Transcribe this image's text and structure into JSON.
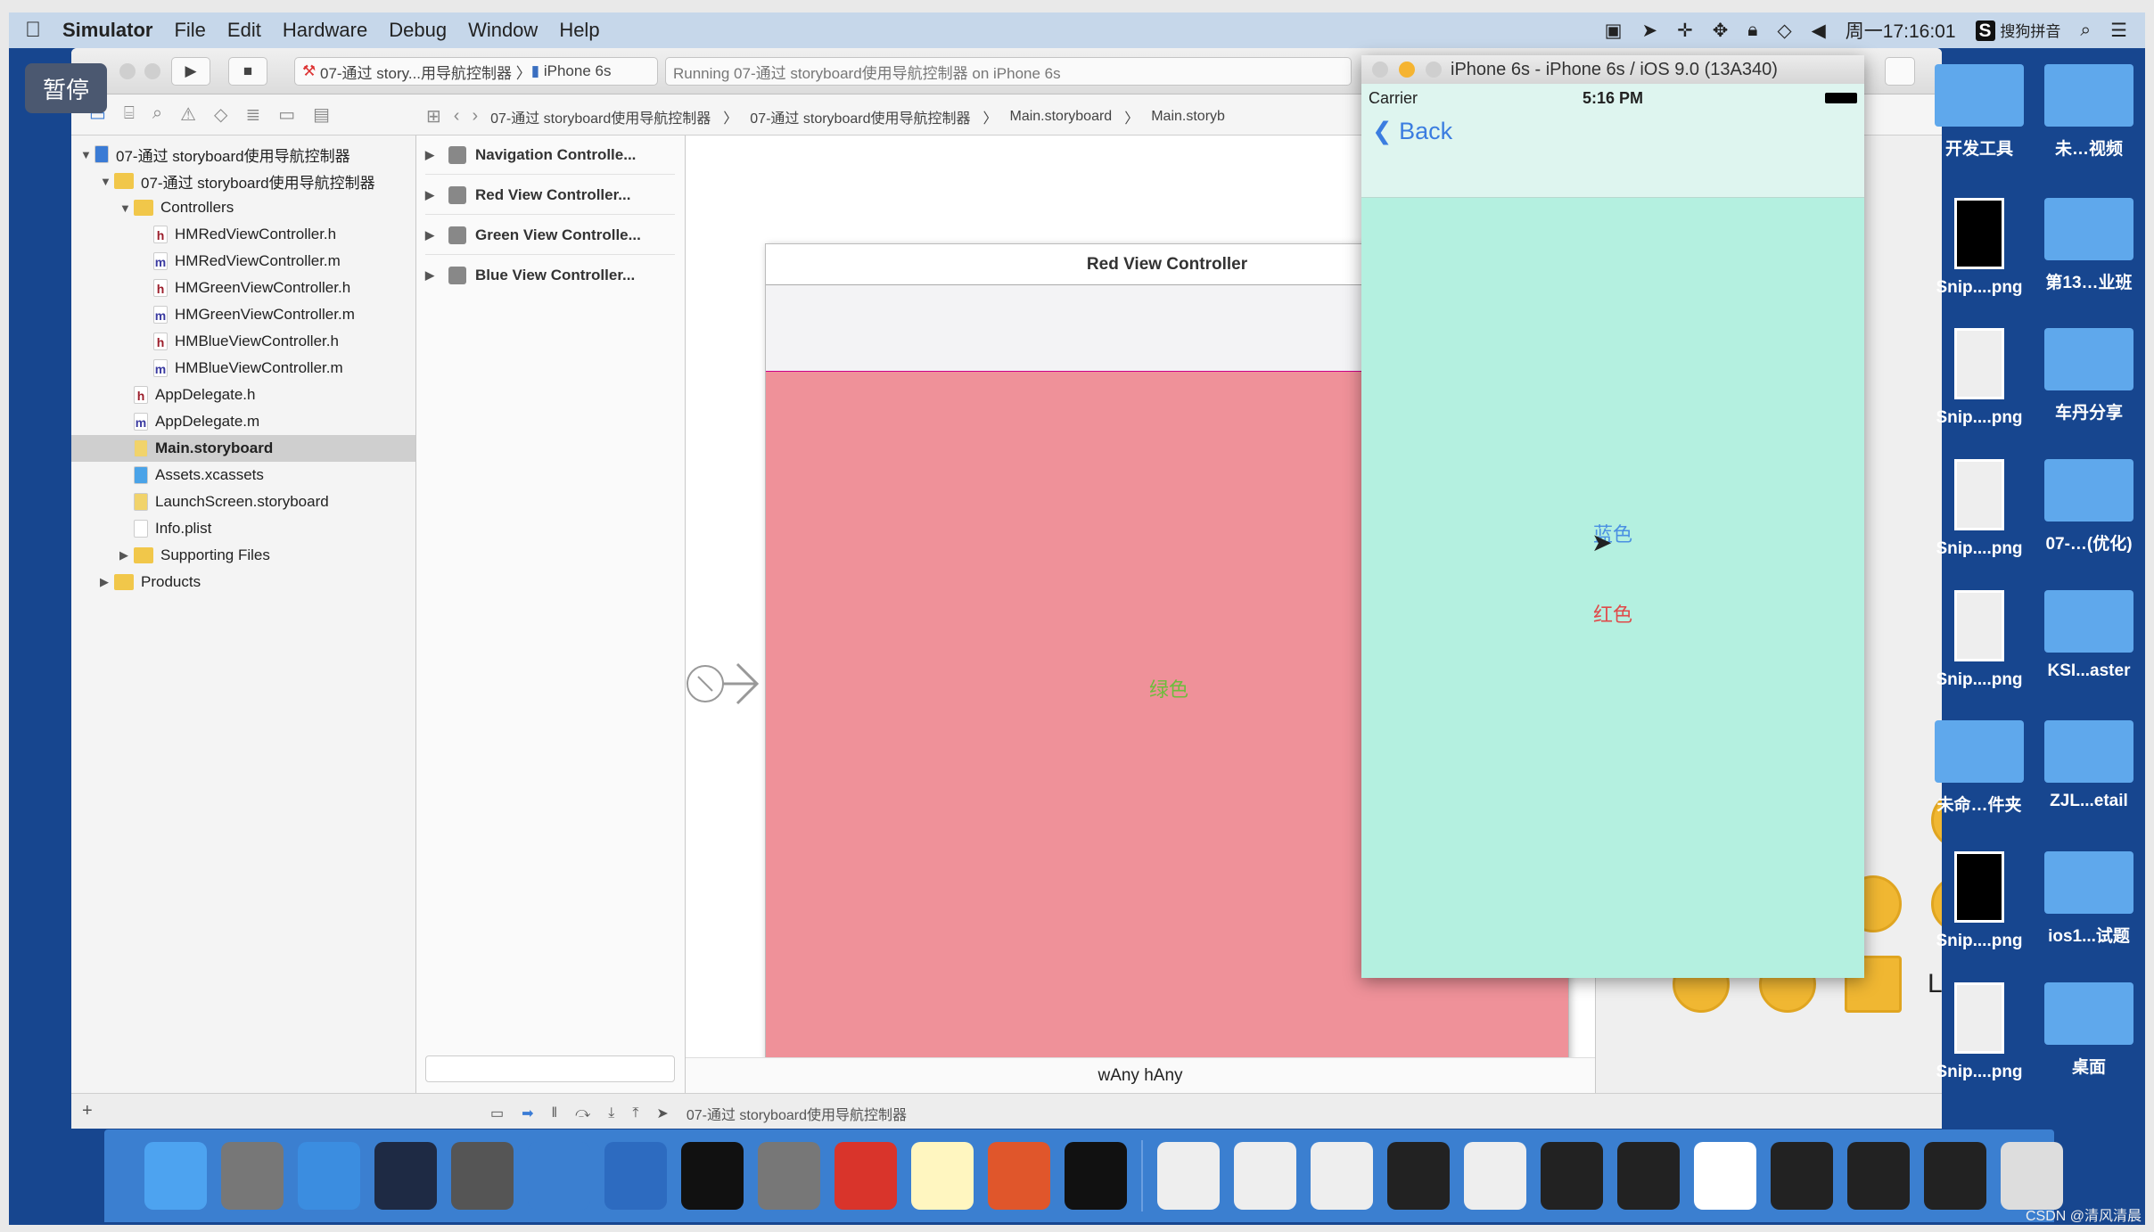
{
  "menubar": {
    "app": "Simulator",
    "items": [
      "File",
      "Edit",
      "Hardware",
      "Debug",
      "Window",
      "Help"
    ],
    "clock": "周一17:16:01",
    "ime": "搜狗拼音"
  },
  "overlay": {
    "pause": "暂停"
  },
  "toolbar": {
    "scheme": "07-通过 story...用导航控制器",
    "device": "iPhone 6s",
    "status": "Running 07-通过 storyboard使用导航控制器 on iPhone 6s"
  },
  "jumpbar": [
    "07-通过 storyboard使用导航控制器",
    "07-通过 storyboard使用导航控制器",
    "Main.storyboard",
    "Main.storyb"
  ],
  "navigator": [
    {
      "label": "07-通过 storyboard使用导航控制器",
      "type": "proj",
      "depth": 0,
      "open": true
    },
    {
      "label": "07-通过 storyboard使用导航控制器",
      "type": "folder",
      "depth": 1,
      "open": true
    },
    {
      "label": "Controllers",
      "type": "folder",
      "depth": 2,
      "open": true
    },
    {
      "label": "HMRedViewController.h",
      "type": "h",
      "depth": 3
    },
    {
      "label": "HMRedViewController.m",
      "type": "m",
      "depth": 3
    },
    {
      "label": "HMGreenViewController.h",
      "type": "h",
      "depth": 3
    },
    {
      "label": "HMGreenViewController.m",
      "type": "m",
      "depth": 3
    },
    {
      "label": "HMBlueViewController.h",
      "type": "h",
      "depth": 3
    },
    {
      "label": "HMBlueViewController.m",
      "type": "m",
      "depth": 3
    },
    {
      "label": "AppDelegate.h",
      "type": "h",
      "depth": 2
    },
    {
      "label": "AppDelegate.m",
      "type": "m",
      "depth": 2
    },
    {
      "label": "Main.storyboard",
      "type": "sb",
      "depth": 2,
      "selected": true
    },
    {
      "label": "Assets.xcassets",
      "type": "assets",
      "depth": 2
    },
    {
      "label": "LaunchScreen.storyboard",
      "type": "sb",
      "depth": 2
    },
    {
      "label": "Info.plist",
      "type": "plist",
      "depth": 2
    },
    {
      "label": "Supporting Files",
      "type": "folder",
      "depth": 2,
      "open": false
    },
    {
      "label": "Products",
      "type": "folder",
      "depth": 1,
      "open": false
    }
  ],
  "outline": [
    "Navigation Controlle...",
    "Red View Controller...",
    "Green View Controlle...",
    "Blue View Controller..."
  ],
  "scene": {
    "title": "Red View Controller",
    "label": "绿色",
    "color": "#ef9199"
  },
  "canvas": {
    "size_class": "wAny hAny"
  },
  "debugbar": {
    "target": "07-通过 storyboard使用导航控制器"
  },
  "library": {
    "label_item": "Label"
  },
  "simulator": {
    "title": "iPhone 6s - iPhone 6s / iOS 9.0 (13A340)",
    "carrier": "Carrier",
    "time": "5:16 PM",
    "back": "Back",
    "blue_label": "蓝色",
    "red_label": "红色",
    "bg": "#b4f0e0"
  },
  "desktop": [
    [
      "开发工具",
      "未…视频"
    ],
    [
      "Snip....png",
      "第13…业班"
    ],
    [
      "Snip....png",
      "车丹分享"
    ],
    [
      "Snip....png",
      "07-…(优化)"
    ],
    [
      "Snip....png",
      "KSI...aster"
    ],
    [
      "未命…件夹",
      "ZJL...etail"
    ],
    [
      "Snip....png",
      "ios1...试题"
    ],
    [
      "Snip....png",
      "桌面"
    ]
  ],
  "watermark": "CSDN @清风清晨"
}
